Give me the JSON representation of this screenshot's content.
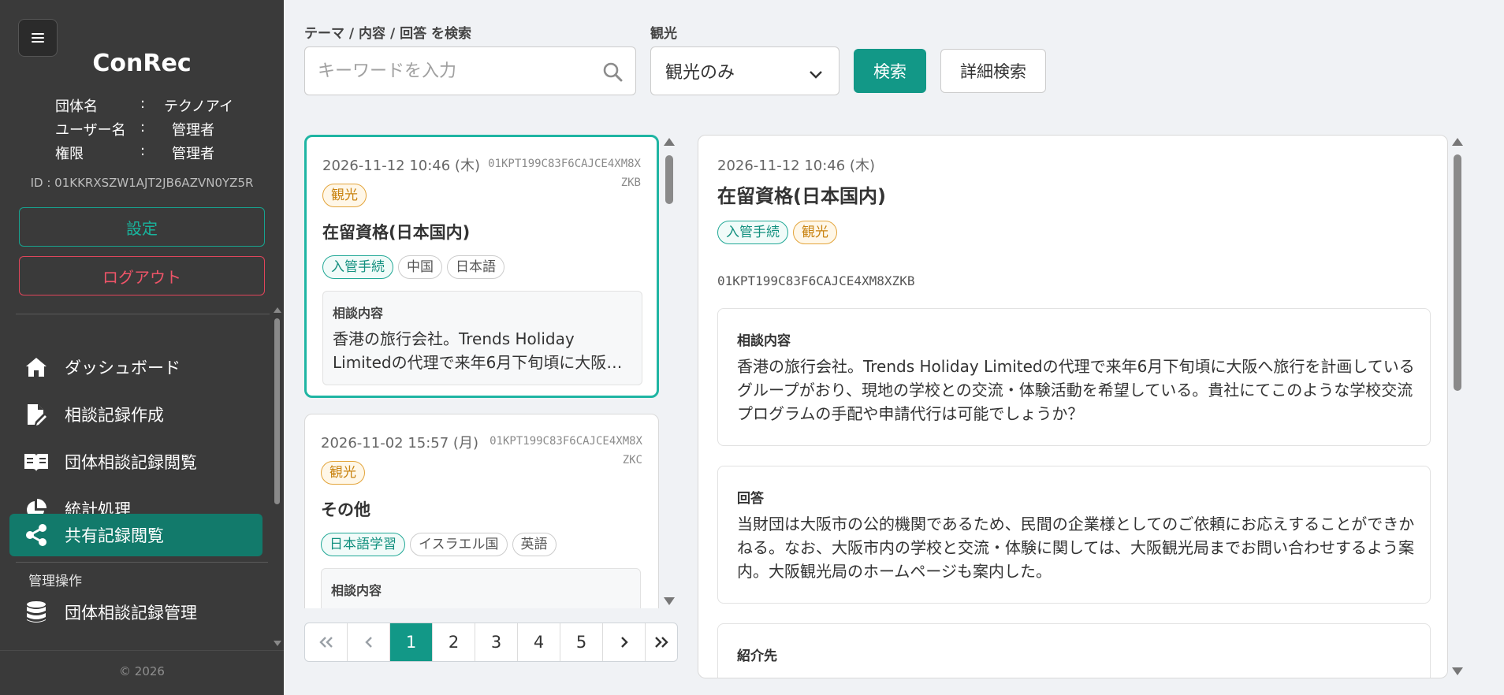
{
  "sidebar": {
    "menu_icon": "hamburger-icon",
    "brand": "ConRec",
    "org_label": "団体名",
    "org_value": "テクノアイ",
    "user_label": "ユーザー名",
    "user_value": "管理者",
    "role_label": "権限",
    "role_value": "管理者",
    "separator": ":",
    "user_id": "ID : 01KKRXSZW1AJT2JB6AZVN0YZ5R",
    "settings_label": "設定",
    "logout_label": "ログアウト",
    "nav": [
      {
        "label": "ダッシュボード",
        "icon": "home-icon"
      },
      {
        "label": "相談記録作成",
        "icon": "edit-document-icon"
      },
      {
        "label": "団体相談記録閲覧",
        "icon": "book-icon"
      },
      {
        "label": "統計処理",
        "icon": "pie-chart-icon"
      },
      {
        "label": "共有記録閲覧",
        "icon": "share-icon",
        "active": true
      }
    ],
    "admin_section": "管理操作",
    "admin_nav": [
      {
        "label": "団体相談記録管理",
        "icon": "database-icon"
      }
    ],
    "copyright": "© 2026"
  },
  "search": {
    "keyword_label": "テーマ / 内容 / 回答 を検索",
    "keyword_placeholder": "キーワードを入力",
    "keyword_value": "",
    "filter_label": "観光",
    "filter_selected": "観光のみ",
    "search_button": "検索",
    "advanced_button": "詳細検索"
  },
  "list": [
    {
      "date": "2026-11-12 10:46 (木)",
      "id": "01KPT199C83F6CAJCE4XM8XZKB",
      "category": "観光",
      "title": "在留資格(日本国内)",
      "tags": [
        {
          "label": "入管手続",
          "style": "teal"
        },
        {
          "label": "中国",
          "style": "plain"
        },
        {
          "label": "日本語",
          "style": "plain"
        }
      ],
      "content_label": "相談内容",
      "content": "香港の旅行会社。Trends Holiday Limitedの代理で来年6月下旬頃に大阪へ旅行を計画しているグループがおり、現地の学校との交流・体験活動を希望している。",
      "selected": true
    },
    {
      "date": "2026-11-02 15:57 (月)",
      "id": "01KPT199C83F6CAJCE4XM8XZKC",
      "category": "観光",
      "title": "その他",
      "tags": [
        {
          "label": "日本語学習",
          "style": "teal"
        },
        {
          "label": "イスラエル国",
          "style": "plain"
        },
        {
          "label": "英語",
          "style": "plain"
        }
      ],
      "content_label": "相談内容",
      "content": "",
      "selected": false
    }
  ],
  "pagination": {
    "first": "«",
    "prev": "‹",
    "pages": [
      "1",
      "2",
      "3",
      "4",
      "5"
    ],
    "current": "1",
    "next": "›",
    "last": "»"
  },
  "detail": {
    "date": "2026-11-12 10:46 (木)",
    "title": "在留資格(日本国内)",
    "tags": [
      {
        "label": "入管手続",
        "style": "teal"
      },
      {
        "label": "観光",
        "style": "orange"
      }
    ],
    "id": "01KPT199C83F6CAJCE4XM8XZKB",
    "content_label": "相談内容",
    "content": "香港の旅行会社。Trends Holiday Limitedの代理で来年6月下旬頃に大阪へ旅行を計画しているグループがおり、現地の学校との交流・体験活動を希望している。貴社にてこのような学校交流プログラムの手配や申請代行は可能でしょうか？",
    "answer_label": "回答",
    "answer": "当財団は大阪市の公的機関であるため、民間の企業様としてのご依頼にお応えすることができかねる。なお、大阪市内の学校と交流・体験に関しては、大阪観光局までお問い合わせするよう案内。大阪観光局のホームページも案内した。",
    "referral_label": "紹介先"
  },
  "colors": {
    "sidebar_bg": "#3a3a3a",
    "accent": "#129887",
    "logout": "#ee5468",
    "tag_teal": "#13907f",
    "tag_orange": "#c98310"
  }
}
